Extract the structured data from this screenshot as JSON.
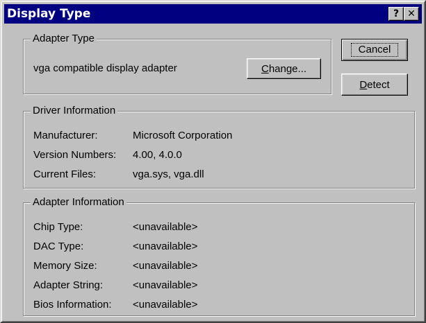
{
  "window": {
    "title": "Display Type",
    "help_label": "?",
    "close_label": "✕"
  },
  "buttons": {
    "cancel": "Cancel",
    "detect_mnemonic": "D",
    "detect_rest": "etect",
    "change_mnemonic": "C",
    "change_rest": "hange..."
  },
  "adapter_type": {
    "label": "Adapter Type",
    "value": "vga compatible display adapter"
  },
  "driver_info": {
    "label": "Driver Information",
    "rows": [
      {
        "key": "Manufacturer:",
        "value": "Microsoft Corporation"
      },
      {
        "key": "Version Numbers:",
        "value": "4.00, 4.0.0"
      },
      {
        "key": "Current Files:",
        "value": "vga.sys, vga.dll"
      }
    ]
  },
  "adapter_info": {
    "label": "Adapter Information",
    "rows": [
      {
        "key": "Chip Type:",
        "value": "<unavailable>"
      },
      {
        "key": "DAC Type:",
        "value": "<unavailable>"
      },
      {
        "key": "Memory Size:",
        "value": "<unavailable>"
      },
      {
        "key": "Adapter String:",
        "value": "<unavailable>"
      },
      {
        "key": "Bios Information:",
        "value": "<unavailable>"
      }
    ]
  },
  "colors": {
    "titlebar": "#000080",
    "face": "#c0c0c0"
  }
}
